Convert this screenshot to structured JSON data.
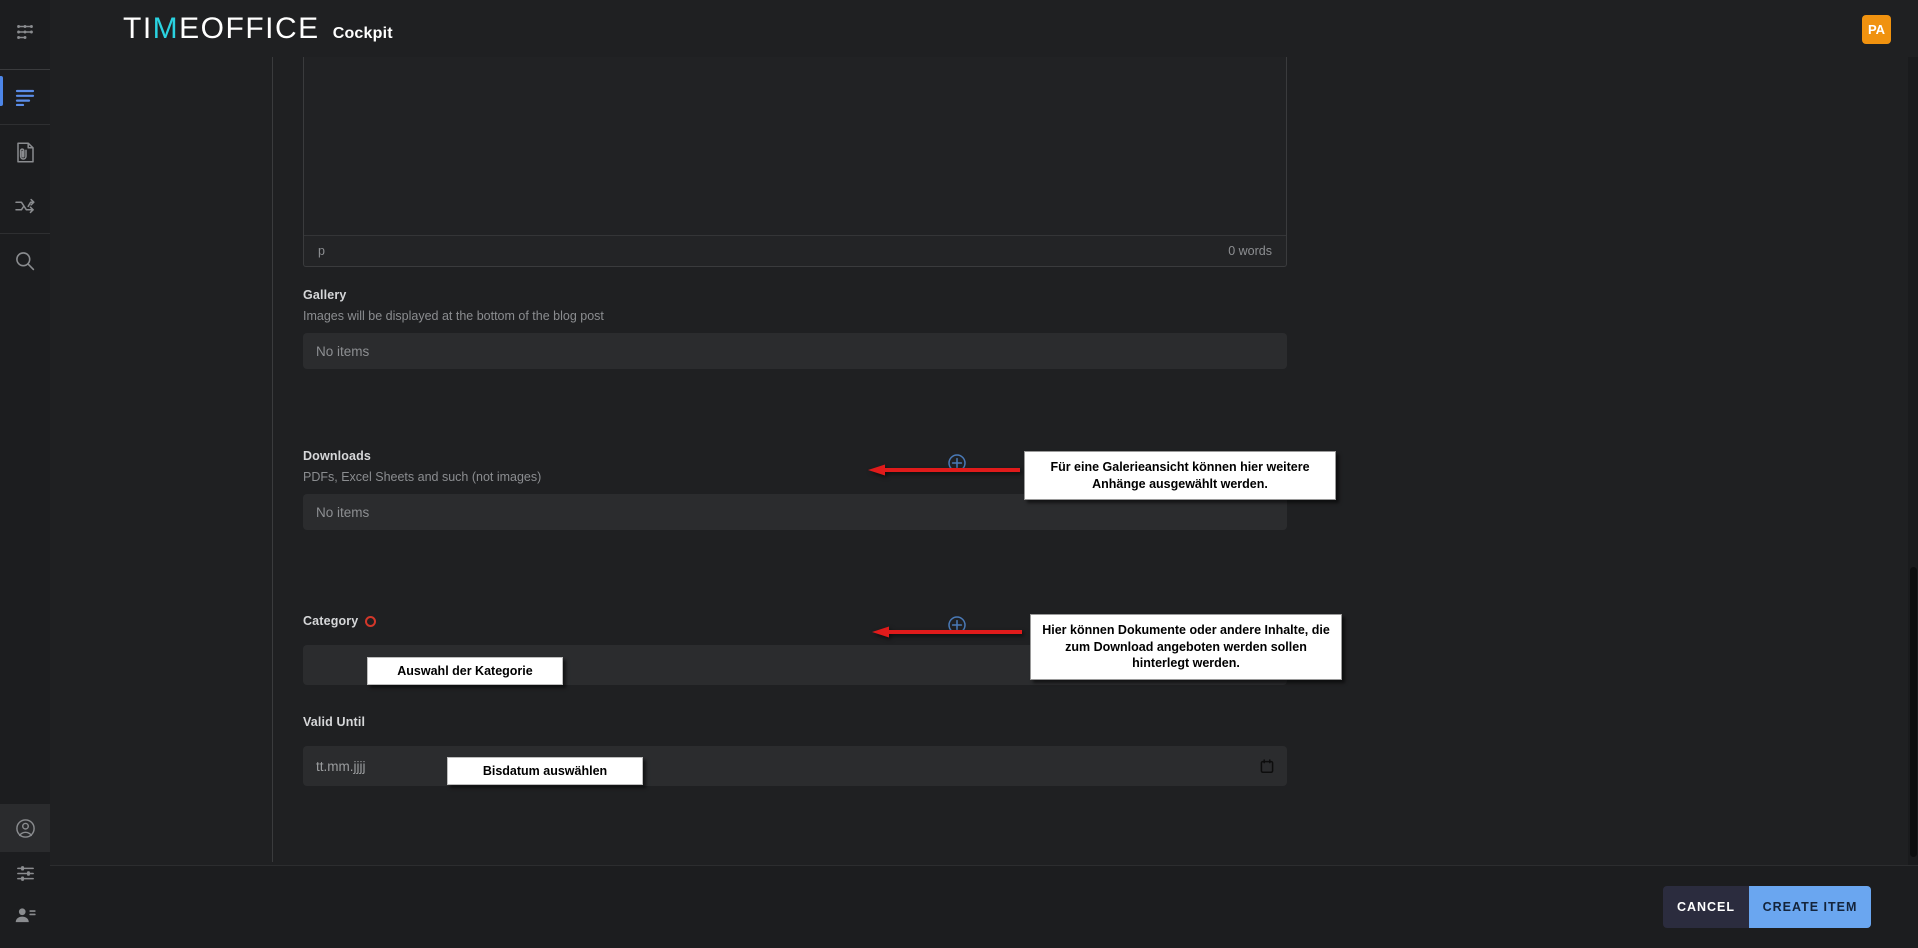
{
  "header": {
    "logo_left": "TI",
    "logo_check": "M",
    "logo_right": "EOFFICE",
    "subtitle": "Cockpit",
    "avatar_initials": "PA"
  },
  "sidebar": {
    "items": [
      {
        "name": "app-menu-icon",
        "label": "App Menu"
      },
      {
        "name": "content-list-icon",
        "label": "Content",
        "active": true
      },
      {
        "name": "attachment-file-icon",
        "label": "Assets"
      },
      {
        "name": "shuffle-swap-icon",
        "label": "Workflows"
      },
      {
        "name": "search-icon",
        "label": "Search"
      },
      {
        "name": "account-circle-icon",
        "label": "Account"
      },
      {
        "name": "settings-sliders-icon",
        "label": "Settings"
      },
      {
        "name": "user-management-icon",
        "label": "Users"
      }
    ]
  },
  "editor": {
    "path_indicator": "p",
    "word_count": "0 words"
  },
  "fields": {
    "gallery": {
      "label": "Gallery",
      "hint": "Images will be displayed at the bottom of the blog post",
      "value": "No items"
    },
    "downloads": {
      "label": "Downloads",
      "hint": "PDFs, Excel Sheets and such (not images)",
      "value": "No items"
    },
    "category": {
      "label": "Category",
      "required": true,
      "value": ""
    },
    "valid_until": {
      "label": "Valid Until",
      "placeholder": "tt.mm.jjjj",
      "calendar_icon": "calendar-icon"
    }
  },
  "annotations": {
    "gallery_callout": "Für eine Galerieansicht können hier weitere Anhänge ausgewählt werden.",
    "downloads_callout": "Hier können Dokumente oder andere Inhalte, die zum Download angeboten werden sollen hinterlegt werden.",
    "category_chip": "Auswahl der Kategorie",
    "date_chip": "Bisdatum auswählen",
    "arrow_color": "#e01b1b"
  },
  "footer": {
    "cancel_label": "CANCEL",
    "create_label": "CREATE ITEM"
  },
  "colors": {
    "accent_blue": "#4d86e8",
    "brand_cyan": "#2ad2e0",
    "avatar_orange": "#f0920f",
    "required_red": "#d3372a",
    "create_button": "#6aa6f0",
    "plus_blue": "#4a7ab8",
    "background": "#1f2022"
  }
}
